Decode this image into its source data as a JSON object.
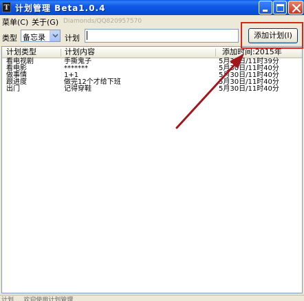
{
  "window": {
    "title": "计划管理 Beta1.0.4",
    "icon_letter": "T",
    "controls": {
      "minimize": "minimize-icon",
      "maximize": "maximize-icon",
      "close": "close-icon"
    }
  },
  "menubar": {
    "items": [
      {
        "label": "菜单(C)"
      },
      {
        "label": "关于(G)"
      }
    ],
    "tip": "Diamonds/QQ820957570"
  },
  "toolbar": {
    "type_label": "类型",
    "type_value": "备忘录",
    "plan_label": "计划",
    "plan_value": "",
    "add_button": "添加计划(I)"
  },
  "list": {
    "columns": [
      "计划类型",
      "计划内容",
      "添加时间:2015年"
    ],
    "rows": [
      {
        "type": "看电视剧",
        "content": "手撕鬼子",
        "time": "5月30日/11时39分"
      },
      {
        "type": "看电影",
        "content": "*******",
        "time": "5月30日/11时40分"
      },
      {
        "type": "做事情",
        "content": "1+1",
        "time": "5月30日/11时40分"
      },
      {
        "type": "跟进度",
        "content": "做完12个才给下班",
        "time": "5月30日/11时40分"
      },
      {
        "type": "出门",
        "content": "记得穿鞋",
        "time": "5月30日/11时40分"
      }
    ]
  },
  "statusbar": {
    "text": "计划 ... 欢迎使用计划管理"
  },
  "colors": {
    "titlebar": "#0750d8",
    "highlight": "#d9251b",
    "arrow": "#a0161c"
  }
}
